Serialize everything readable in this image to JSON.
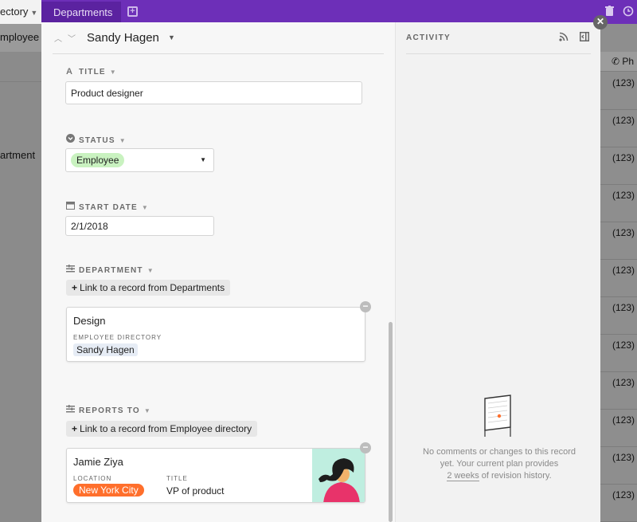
{
  "topbar": {
    "tab_directory": "ectory",
    "tab_departments": "Departments",
    "add_icon": "+",
    "trash_icon": "trash-icon",
    "history_icon": "history-icon"
  },
  "background": {
    "left_header": "mployee",
    "left_department": "artment",
    "right_header": "Ph",
    "phone_prefix": "(123)",
    "phone_rows": [
      "(123)",
      "(123)",
      "(123)",
      "(123)",
      "(123)",
      "(123)",
      "(123)",
      "(123)",
      "(123)",
      "(123)",
      "(123)",
      "(123)"
    ]
  },
  "record": {
    "name": "Sandy Hagen",
    "fields": {
      "title": {
        "label": "TITLE",
        "value": "Product designer"
      },
      "status": {
        "label": "STATUS",
        "value": "Employee",
        "pill_color": "#c9f2c0"
      },
      "start_date": {
        "label": "START DATE",
        "value": "2/1/2018"
      },
      "department": {
        "label": "DEPARTMENT",
        "link_label": "Link to a record from Departments",
        "card": {
          "title": "Design",
          "sub_label": "EMPLOYEE DIRECTORY",
          "sub_value": "Sandy Hagen"
        }
      },
      "reports_to": {
        "label": "REPORTS TO",
        "link_label": "Link to a record from Employee directory",
        "card": {
          "title": "Jamie Ziya",
          "location_label": "LOCATION",
          "location_value": "New York City",
          "location_color": "#ff6f2c",
          "title_label": "TITLE",
          "title_value": "VP of product"
        }
      }
    }
  },
  "activity": {
    "title": "ACTIVITY",
    "empty_line1": "No comments or changes to this record",
    "empty_line2": "yet. Your current plan provides",
    "empty_link": "2 weeks",
    "empty_line3": " of revision history."
  },
  "colors": {
    "topbar": "#6d2fb8",
    "panel": "#f7f7f7",
    "accent_orange": "#ff6f2c"
  }
}
